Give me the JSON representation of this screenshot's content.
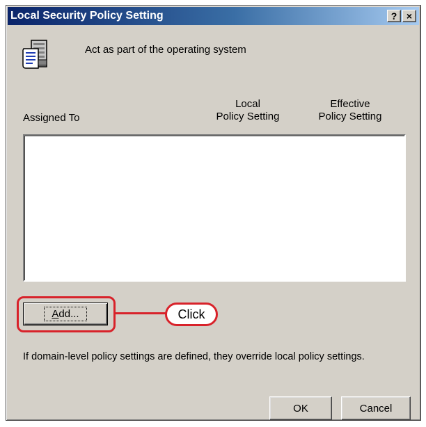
{
  "window": {
    "title": "Local Security Policy Setting",
    "help_button": "?",
    "close_button": "×"
  },
  "policy": {
    "name": "Act as part of the operating system",
    "icon": "policy-document-icon"
  },
  "columns": {
    "assigned_to": "Assigned To",
    "local_line1": "Local",
    "local_line2": "Policy Setting",
    "effective_line1": "Effective",
    "effective_line2": "Policy Setting"
  },
  "list": {
    "items": []
  },
  "buttons": {
    "add_underlined": "A",
    "add_rest": "dd...",
    "ok": "OK",
    "cancel": "Cancel"
  },
  "annotation": {
    "callout_text": "Click",
    "color": "#d8222a"
  },
  "note": "If domain-level policy settings are defined, they override local policy settings."
}
